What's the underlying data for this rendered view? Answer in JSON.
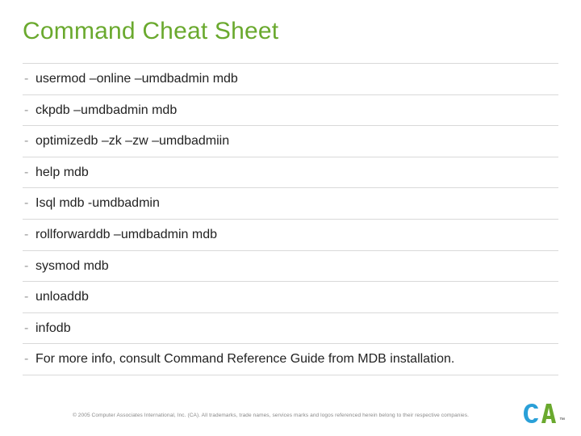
{
  "title": "Command Cheat Sheet",
  "items": [
    "usermod –online –umdbadmin mdb",
    "ckpdb –umdbadmin mdb",
    "optimizedb –zk –zw –umdbadmiin",
    "help mdb",
    "Isql mdb -umdbadmin",
    "rollforwarddb –umdbadmin mdb",
    "sysmod mdb",
    "unloaddb",
    "infodb",
    "For more info, consult Command Reference Guide from MDB installation."
  ],
  "footer": "© 2005 Computer Associates International, Inc. (CA). All trademarks, trade names, services marks and logos referenced herein belong to their respective companies.",
  "logo_tm": "™"
}
